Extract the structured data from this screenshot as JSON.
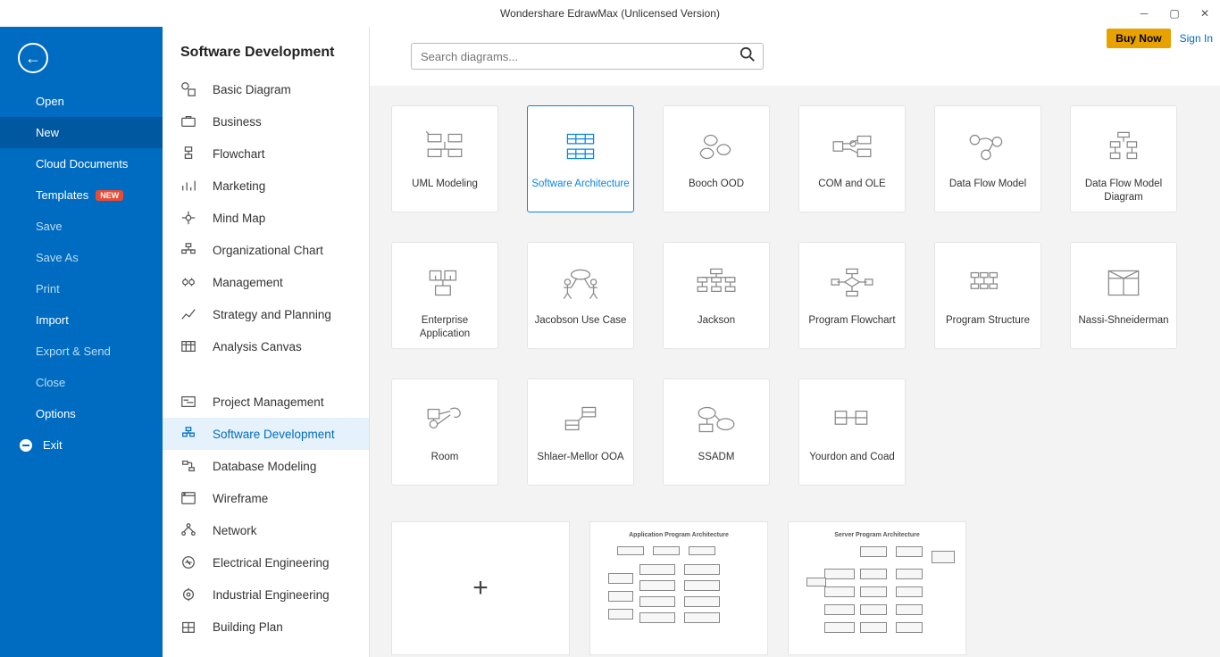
{
  "titlebar": {
    "title": "Wondershare EdrawMax (Unlicensed Version)"
  },
  "topright": {
    "buy": "Buy Now",
    "signin": "Sign In"
  },
  "sidebar": {
    "items": [
      {
        "label": "Open",
        "style": "bright"
      },
      {
        "label": "New",
        "style": "bright",
        "active": true
      },
      {
        "label": "Cloud Documents",
        "style": "bright"
      },
      {
        "label": "Templates",
        "style": "bright",
        "badge": "NEW"
      },
      {
        "label": "Save",
        "style": "dim"
      },
      {
        "label": "Save As",
        "style": "dim"
      },
      {
        "label": "Print",
        "style": "dim"
      },
      {
        "label": "Import",
        "style": "bright"
      },
      {
        "label": "Export & Send",
        "style": "dim"
      },
      {
        "label": "Close",
        "style": "dim"
      },
      {
        "label": "Options",
        "style": "bright"
      },
      {
        "label": "Exit",
        "style": "bright",
        "icon": "exit"
      }
    ]
  },
  "categories": {
    "title": "Software Development",
    "group1": [
      {
        "label": "Basic Diagram",
        "icon": "basic"
      },
      {
        "label": "Business",
        "icon": "business"
      },
      {
        "label": "Flowchart",
        "icon": "flow"
      },
      {
        "label": "Marketing",
        "icon": "marketing"
      },
      {
        "label": "Mind Map",
        "icon": "mindmap"
      },
      {
        "label": "Organizational Chart",
        "icon": "org"
      },
      {
        "label": "Management",
        "icon": "mgmt"
      },
      {
        "label": "Strategy and Planning",
        "icon": "strategy"
      },
      {
        "label": "Analysis Canvas",
        "icon": "canvas"
      }
    ],
    "group2": [
      {
        "label": "Project Management",
        "icon": "project"
      },
      {
        "label": "Software Development",
        "icon": "software",
        "selected": true
      },
      {
        "label": "Database Modeling",
        "icon": "db"
      },
      {
        "label": "Wireframe",
        "icon": "wire"
      },
      {
        "label": "Network",
        "icon": "network"
      },
      {
        "label": "Electrical Engineering",
        "icon": "elec"
      },
      {
        "label": "Industrial Engineering",
        "icon": "ind"
      },
      {
        "label": "Building Plan",
        "icon": "build"
      }
    ]
  },
  "search": {
    "placeholder": "Search diagrams..."
  },
  "tiles": [
    {
      "label": "UML Modeling",
      "icon": "uml"
    },
    {
      "label": "Software Architecture",
      "icon": "arch",
      "selected": true
    },
    {
      "label": "Booch OOD",
      "icon": "booch"
    },
    {
      "label": "COM and OLE",
      "icon": "com"
    },
    {
      "label": "Data Flow Model",
      "icon": "dfm"
    },
    {
      "label": "Data Flow Model Diagram",
      "icon": "dfmd"
    },
    {
      "label": "Enterprise Application",
      "icon": "ea"
    },
    {
      "label": "Jacobson Use Case",
      "icon": "juc"
    },
    {
      "label": "Jackson",
      "icon": "jackson"
    },
    {
      "label": "Program Flowchart",
      "icon": "pf"
    },
    {
      "label": "Program Structure",
      "icon": "ps"
    },
    {
      "label": "Nassi-Shneiderman",
      "icon": "ns"
    },
    {
      "label": "Room",
      "icon": "room"
    },
    {
      "label": "Shlaer-Mellor OOA",
      "icon": "sm"
    },
    {
      "label": "SSADM",
      "icon": "ssadm"
    },
    {
      "label": "Yourdon and Coad",
      "icon": "yc"
    }
  ],
  "templates": [
    {
      "kind": "blank"
    },
    {
      "kind": "diagram",
      "title": "Application Program Architecture"
    },
    {
      "kind": "diagram",
      "title": "Server Program Architecture"
    }
  ]
}
